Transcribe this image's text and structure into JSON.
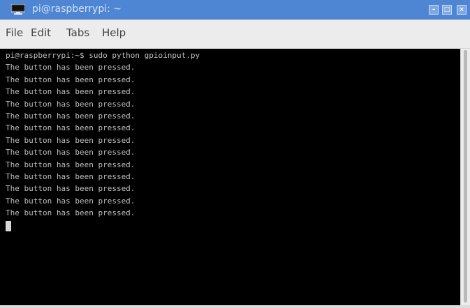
{
  "window": {
    "title": "pi@raspberrypi: ~",
    "accent_color": "#4f86d4",
    "icon": "terminal-icon",
    "controls": {
      "minimize": "–",
      "maximize": "□",
      "close": "×"
    }
  },
  "menu": {
    "items": [
      {
        "label": "File"
      },
      {
        "label": "Edit"
      },
      {
        "label": "Tabs"
      },
      {
        "label": "Help"
      }
    ]
  },
  "terminal": {
    "prompt_line": "pi@raspberrypi:~$ sudo python gpioinput.py",
    "output": [
      "The button has been pressed.",
      "The button has been pressed.",
      "The button has been pressed.",
      "The button has been pressed.",
      "The button has been pressed.",
      "The button has been pressed.",
      "The button has been pressed.",
      "The button has been pressed.",
      "The button has been pressed.",
      "The button has been pressed.",
      "The button has been pressed.",
      "The button has been pressed.",
      "The button has been pressed."
    ],
    "background_color": "#000000",
    "text_color": "#bcbcbc"
  }
}
